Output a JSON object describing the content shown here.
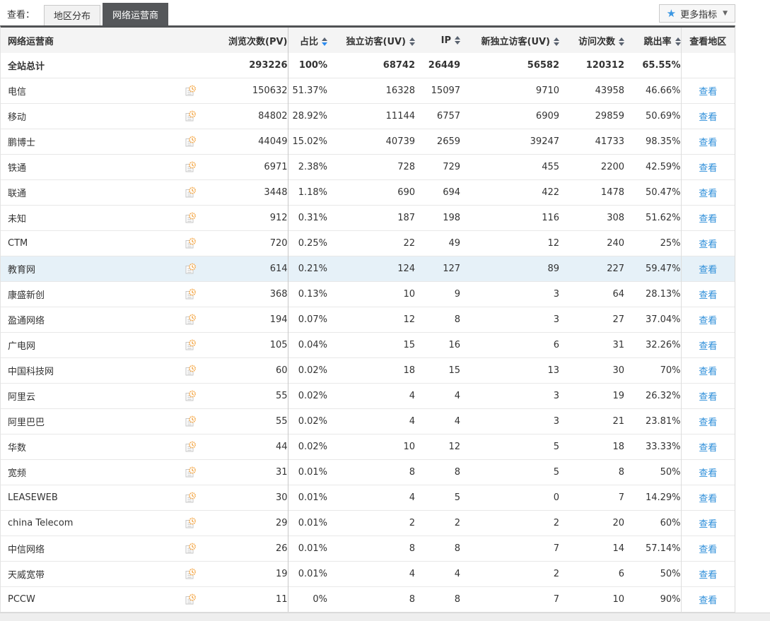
{
  "toolbar": {
    "view_label": "查看：",
    "tabs": [
      {
        "label": "地区分布",
        "active": false
      },
      {
        "label": "网络运营商",
        "active": true
      }
    ],
    "more_metrics": {
      "star": "★",
      "label": "更多指标",
      "caret": "▼"
    }
  },
  "table": {
    "columns": [
      {
        "key": "name",
        "label": "网络运营商",
        "sortable": false
      },
      {
        "key": "pv",
        "label": "浏览次数(PV)",
        "sortable": false
      },
      {
        "key": "ratio",
        "label": "占比",
        "sortable": true,
        "sort": "desc"
      },
      {
        "key": "uv",
        "label": "独立访客(UV)",
        "sortable": true
      },
      {
        "key": "ip",
        "label": "IP",
        "sortable": true
      },
      {
        "key": "new_uv",
        "label": "新独立访客(UV)",
        "sortable": true
      },
      {
        "key": "visits",
        "label": "访问次数",
        "sortable": true
      },
      {
        "key": "bounce",
        "label": "跳出率",
        "sortable": true
      },
      {
        "key": "region",
        "label": "查看地区",
        "sortable": false
      }
    ],
    "view_link_label": "查看",
    "total_row": {
      "name": "全站总计",
      "pv": "293226",
      "ratio": "100%",
      "uv": "68742",
      "ip": "26449",
      "new_uv": "56582",
      "visits": "120312",
      "bounce": "65.55%"
    },
    "rows": [
      {
        "name": "电信",
        "pv": "150632",
        "ratio": "51.37%",
        "uv": "16328",
        "ip": "15097",
        "new_uv": "9710",
        "visits": "43958",
        "bounce": "46.66%"
      },
      {
        "name": "移动",
        "pv": "84802",
        "ratio": "28.92%",
        "uv": "11144",
        "ip": "6757",
        "new_uv": "6909",
        "visits": "29859",
        "bounce": "50.69%"
      },
      {
        "name": "鹏博士",
        "pv": "44049",
        "ratio": "15.02%",
        "uv": "40739",
        "ip": "2659",
        "new_uv": "39247",
        "visits": "41733",
        "bounce": "98.35%"
      },
      {
        "name": "铁通",
        "pv": "6971",
        "ratio": "2.38%",
        "uv": "728",
        "ip": "729",
        "new_uv": "455",
        "visits": "2200",
        "bounce": "42.59%"
      },
      {
        "name": "联通",
        "pv": "3448",
        "ratio": "1.18%",
        "uv": "690",
        "ip": "694",
        "new_uv": "422",
        "visits": "1478",
        "bounce": "50.47%"
      },
      {
        "name": "未知",
        "pv": "912",
        "ratio": "0.31%",
        "uv": "187",
        "ip": "198",
        "new_uv": "116",
        "visits": "308",
        "bounce": "51.62%"
      },
      {
        "name": "CTM",
        "pv": "720",
        "ratio": "0.25%",
        "uv": "22",
        "ip": "49",
        "new_uv": "12",
        "visits": "240",
        "bounce": "25%"
      },
      {
        "name": "教育网",
        "pv": "614",
        "ratio": "0.21%",
        "uv": "124",
        "ip": "127",
        "new_uv": "89",
        "visits": "227",
        "bounce": "59.47%",
        "highlighted": true
      },
      {
        "name": "康盛新创",
        "pv": "368",
        "ratio": "0.13%",
        "uv": "10",
        "ip": "9",
        "new_uv": "3",
        "visits": "64",
        "bounce": "28.13%"
      },
      {
        "name": "盈通网络",
        "pv": "194",
        "ratio": "0.07%",
        "uv": "12",
        "ip": "8",
        "new_uv": "3",
        "visits": "27",
        "bounce": "37.04%"
      },
      {
        "name": "广电网",
        "pv": "105",
        "ratio": "0.04%",
        "uv": "15",
        "ip": "16",
        "new_uv": "6",
        "visits": "31",
        "bounce": "32.26%"
      },
      {
        "name": "中国科技网",
        "pv": "60",
        "ratio": "0.02%",
        "uv": "18",
        "ip": "15",
        "new_uv": "13",
        "visits": "30",
        "bounce": "70%"
      },
      {
        "name": "阿里云",
        "pv": "55",
        "ratio": "0.02%",
        "uv": "4",
        "ip": "4",
        "new_uv": "3",
        "visits": "19",
        "bounce": "26.32%"
      },
      {
        "name": "阿里巴巴",
        "pv": "55",
        "ratio": "0.02%",
        "uv": "4",
        "ip": "4",
        "new_uv": "3",
        "visits": "21",
        "bounce": "23.81%"
      },
      {
        "name": "华数",
        "pv": "44",
        "ratio": "0.02%",
        "uv": "10",
        "ip": "12",
        "new_uv": "5",
        "visits": "18",
        "bounce": "33.33%"
      },
      {
        "name": "宽频",
        "pv": "31",
        "ratio": "0.01%",
        "uv": "8",
        "ip": "8",
        "new_uv": "5",
        "visits": "8",
        "bounce": "50%"
      },
      {
        "name": "LEASEWEB",
        "pv": "30",
        "ratio": "0.01%",
        "uv": "4",
        "ip": "5",
        "new_uv": "0",
        "visits": "7",
        "bounce": "14.29%"
      },
      {
        "name": "china Telecom",
        "pv": "29",
        "ratio": "0.01%",
        "uv": "2",
        "ip": "2",
        "new_uv": "2",
        "visits": "20",
        "bounce": "60%"
      },
      {
        "name": "中信网络",
        "pv": "26",
        "ratio": "0.01%",
        "uv": "8",
        "ip": "8",
        "new_uv": "7",
        "visits": "14",
        "bounce": "57.14%"
      },
      {
        "name": "天威宽带",
        "pv": "19",
        "ratio": "0.01%",
        "uv": "4",
        "ip": "4",
        "new_uv": "2",
        "visits": "6",
        "bounce": "50%"
      },
      {
        "name": "PCCW",
        "pv": "11",
        "ratio": "0%",
        "uv": "8",
        "ip": "8",
        "new_uv": "7",
        "visits": "10",
        "bounce": "90%"
      }
    ]
  }
}
